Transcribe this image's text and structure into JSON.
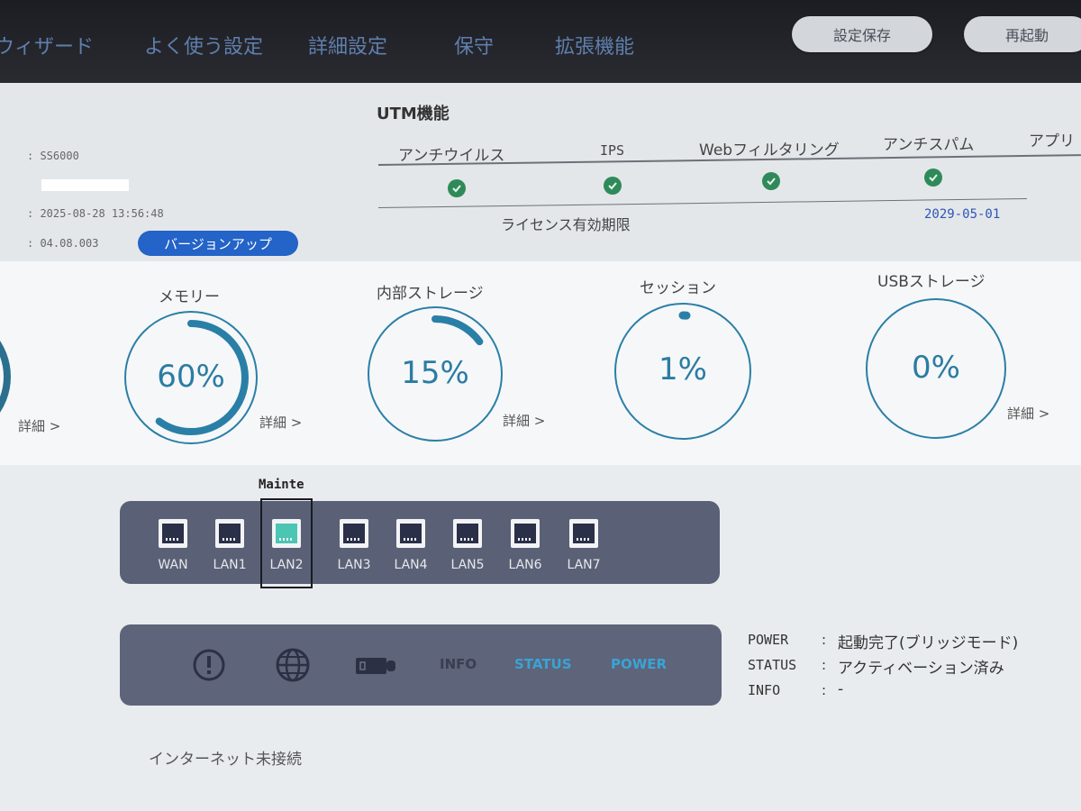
{
  "nav": {
    "items": [
      "ウィザード",
      "よく使う設定",
      "詳細設定",
      "保守",
      "拡張機能"
    ],
    "save_button": "設定保存",
    "reboot_button": "再起動"
  },
  "device": {
    "model": ": SS6000",
    "datetime": ": 2025-08-28 13:56:48",
    "firmware": ": 04.08.003",
    "version_up_button": "バージョンアップ"
  },
  "utm": {
    "title": "UTM機能",
    "columns": [
      "アンチウイルス",
      "IPS",
      "Webフィルタリング",
      "アンチスパム",
      "アプリ"
    ],
    "license_label": "ライセンス有効期限",
    "license_date": "2029-05-01"
  },
  "gauges": [
    {
      "label": "メモリー",
      "value_text": "60%",
      "percent": 60,
      "detail": "詳細 >"
    },
    {
      "label": "内部ストレージ",
      "value_text": "15%",
      "percent": 15,
      "detail": "詳細 >"
    },
    {
      "label": "セッション",
      "value_text": "1%",
      "percent": 1,
      "detail": ""
    },
    {
      "label": "USBストレージ",
      "value_text": "0%",
      "percent": 0,
      "detail": "詳細 >"
    }
  ],
  "left_detail": "詳細 >",
  "ports": {
    "mainte_label": "Mainte",
    "items": [
      {
        "label": "WAN",
        "active": false
      },
      {
        "label": "LAN1",
        "active": false
      },
      {
        "label": "LAN2",
        "active": true
      },
      {
        "label": "LAN3",
        "active": false
      },
      {
        "label": "LAN4",
        "active": false
      },
      {
        "label": "LAN5",
        "active": false
      },
      {
        "label": "LAN6",
        "active": false
      },
      {
        "label": "LAN7",
        "active": false
      }
    ]
  },
  "status_panel": {
    "info": "INFO",
    "status": "STATUS",
    "power": "POWER"
  },
  "status_lines": [
    {
      "key": "POWER",
      "colon": ":",
      "value": "起動完了(ブリッジモード)"
    },
    {
      "key": "STATUS",
      "colon": ":",
      "value": "アクティベーション済み"
    },
    {
      "key": "INFO",
      "colon": ":",
      "value": "-"
    }
  ],
  "internet_status": "インターネット未接続",
  "colors": {
    "accent": "#2b7ca3",
    "ok": "#2f8a5a",
    "active_port": "#4cc5b3",
    "status_lit": "#3aa3d6"
  }
}
